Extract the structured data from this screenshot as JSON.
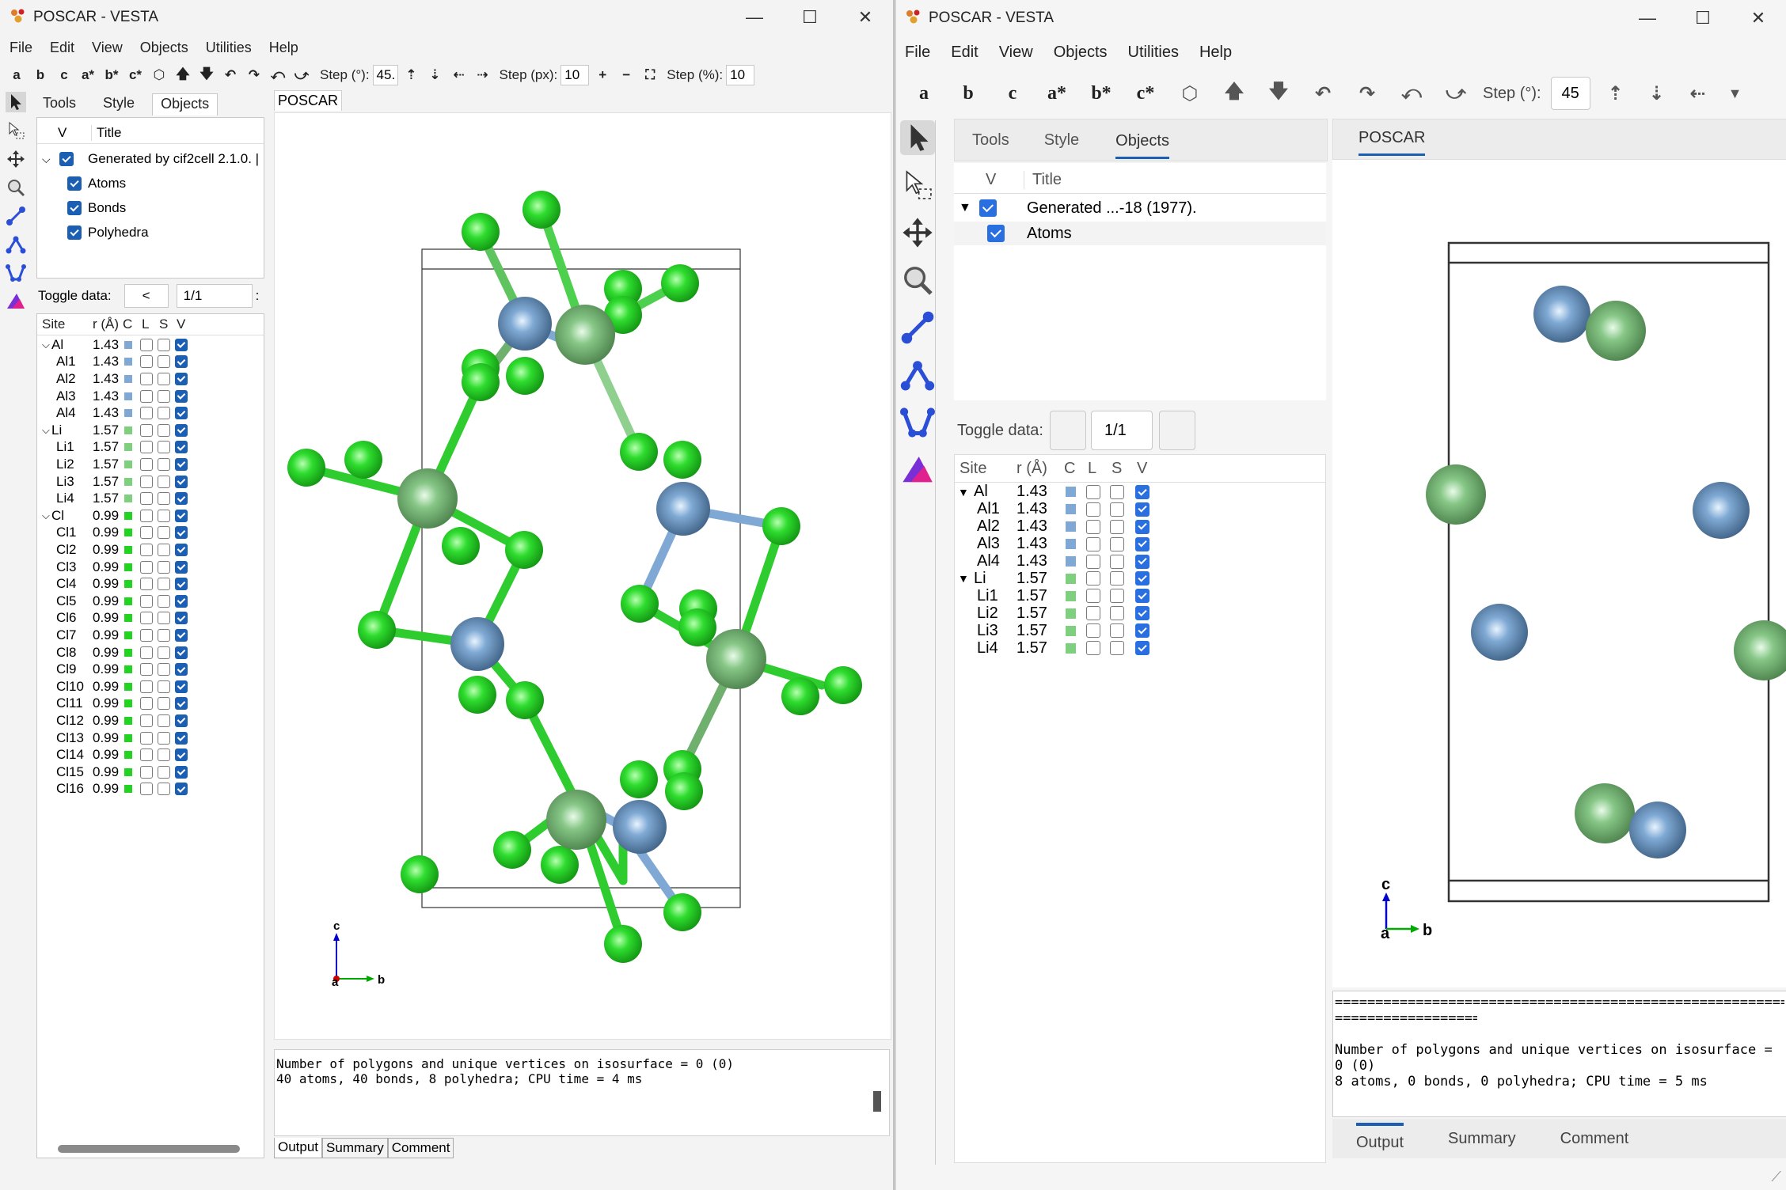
{
  "left": {
    "window_title": "POSCAR - VESTA",
    "menu": [
      "File",
      "Edit",
      "View",
      "Objects",
      "Utilities",
      "Help"
    ],
    "toolbar": {
      "axis_buttons": [
        "a",
        "b",
        "c",
        "a*",
        "b*",
        "c*"
      ],
      "step_deg_label": "Step (°):",
      "step_deg_value": "45.",
      "step_px_label": "Step (px):",
      "step_px_value": "10",
      "step_pct_label": "Step (%):",
      "step_pct_value": "10"
    },
    "side_tabs": [
      "Tools",
      "Style",
      "Objects"
    ],
    "objects_header": {
      "v": "V",
      "title": "Title"
    },
    "objects": [
      {
        "label": "Generated by cif2cell 2.1.0. |",
        "checked": true
      },
      {
        "label": "Atoms",
        "checked": true
      },
      {
        "label": "Bonds",
        "checked": true
      },
      {
        "label": "Polyhedra",
        "checked": true
      }
    ],
    "toggle_data": {
      "label": "Toggle data:",
      "prev": "<",
      "value": "1/1",
      "more": ":"
    },
    "site_headers": [
      "Site",
      "r (Å)",
      "C",
      "L",
      "S",
      "V"
    ],
    "sites": [
      {
        "name": "Al",
        "r": "1.43",
        "group": true,
        "color": "#7fa9d4"
      },
      {
        "name": "Al1",
        "r": "1.43",
        "color": "#7fa9d4"
      },
      {
        "name": "Al2",
        "r": "1.43",
        "color": "#7fa9d4"
      },
      {
        "name": "Al3",
        "r": "1.43",
        "color": "#7fa9d4"
      },
      {
        "name": "Al4",
        "r": "1.43",
        "color": "#7fa9d4"
      },
      {
        "name": "Li",
        "r": "1.57",
        "group": true,
        "color": "#7ed07e"
      },
      {
        "name": "Li1",
        "r": "1.57",
        "color": "#7ed07e"
      },
      {
        "name": "Li2",
        "r": "1.57",
        "color": "#7ed07e"
      },
      {
        "name": "Li3",
        "r": "1.57",
        "color": "#7ed07e"
      },
      {
        "name": "Li4",
        "r": "1.57",
        "color": "#7ed07e"
      },
      {
        "name": "Cl",
        "r": "0.99",
        "group": true,
        "color": "#22d322"
      },
      {
        "name": "Cl1",
        "r": "0.99",
        "color": "#22d322"
      },
      {
        "name": "Cl2",
        "r": "0.99",
        "color": "#22d322"
      },
      {
        "name": "Cl3",
        "r": "0.99",
        "color": "#22d322"
      },
      {
        "name": "Cl4",
        "r": "0.99",
        "color": "#22d322"
      },
      {
        "name": "Cl5",
        "r": "0.99",
        "color": "#22d322"
      },
      {
        "name": "Cl6",
        "r": "0.99",
        "color": "#22d322"
      },
      {
        "name": "Cl7",
        "r": "0.99",
        "color": "#22d322"
      },
      {
        "name": "Cl8",
        "r": "0.99",
        "color": "#22d322"
      },
      {
        "name": "Cl9",
        "r": "0.99",
        "color": "#22d322"
      },
      {
        "name": "Cl10",
        "r": "0.99",
        "color": "#22d322"
      },
      {
        "name": "Cl11",
        "r": "0.99",
        "color": "#22d322"
      },
      {
        "name": "Cl12",
        "r": "0.99",
        "color": "#22d322"
      },
      {
        "name": "Cl13",
        "r": "0.99",
        "color": "#22d322"
      },
      {
        "name": "Cl14",
        "r": "0.99",
        "color": "#22d322"
      },
      {
        "name": "Cl15",
        "r": "0.99",
        "color": "#22d322"
      },
      {
        "name": "Cl16",
        "r": "0.99",
        "color": "#22d322"
      }
    ],
    "view_tab": "POSCAR",
    "axes": {
      "a": "a",
      "b": "b",
      "c": "c"
    },
    "output_lines": [
      "Number of polygons and unique vertices on isosurface = 0 (0)",
      "40 atoms, 40 bonds, 8 polyhedra; CPU time = 4 ms"
    ],
    "bottom_tabs": [
      "Output",
      "Summary",
      "Comment"
    ]
  },
  "right": {
    "window_title": "POSCAR - VESTA",
    "menu": [
      "File",
      "Edit",
      "View",
      "Objects",
      "Utilities",
      "Help"
    ],
    "toolbar": {
      "axis_buttons": [
        "a",
        "b",
        "c",
        "a*",
        "b*",
        "c*"
      ],
      "step_deg_label": "Step (°):",
      "step_deg_value": "45"
    },
    "side_tabs": [
      "Tools",
      "Style",
      "Objects"
    ],
    "objects_header": {
      "v": "V",
      "title": "Title"
    },
    "objects": [
      {
        "label": "Generated ...-18 (1977).",
        "checked": true
      },
      {
        "label": "Atoms",
        "checked": true
      }
    ],
    "toggle_data": {
      "label": "Toggle data:",
      "value": "1/1"
    },
    "site_headers": [
      "Site",
      "r (Å)",
      "C",
      "L",
      "S",
      "V"
    ],
    "sites": [
      {
        "name": "Al",
        "r": "1.43",
        "group": true,
        "color": "#7fa9d4"
      },
      {
        "name": "Al1",
        "r": "1.43",
        "color": "#7fa9d4"
      },
      {
        "name": "Al2",
        "r": "1.43",
        "color": "#7fa9d4"
      },
      {
        "name": "Al3",
        "r": "1.43",
        "color": "#7fa9d4"
      },
      {
        "name": "Al4",
        "r": "1.43",
        "color": "#7fa9d4"
      },
      {
        "name": "Li",
        "r": "1.57",
        "group": true,
        "color": "#7ed07e"
      },
      {
        "name": "Li1",
        "r": "1.57",
        "color": "#7ed07e"
      },
      {
        "name": "Li2",
        "r": "1.57",
        "color": "#7ed07e"
      },
      {
        "name": "Li3",
        "r": "1.57",
        "color": "#7ed07e"
      },
      {
        "name": "Li4",
        "r": "1.57",
        "color": "#7ed07e"
      }
    ],
    "view_tab": "POSCAR",
    "axes": {
      "a": "a",
      "b": "b",
      "c": "c"
    },
    "output_rule": "==================================================================================",
    "output_lines": [
      "Number of polygons and unique vertices on isosurface = 0 (0)",
      "8 atoms, 0 bonds, 0 polyhedra; CPU time = 5 ms"
    ],
    "bottom_tabs": [
      "Output",
      "Summary",
      "Comment"
    ]
  },
  "colors": {
    "al": "#7fa9d4",
    "li": "#7ed07e",
    "cl": "#22d322",
    "accent": "#1a5fb4"
  }
}
